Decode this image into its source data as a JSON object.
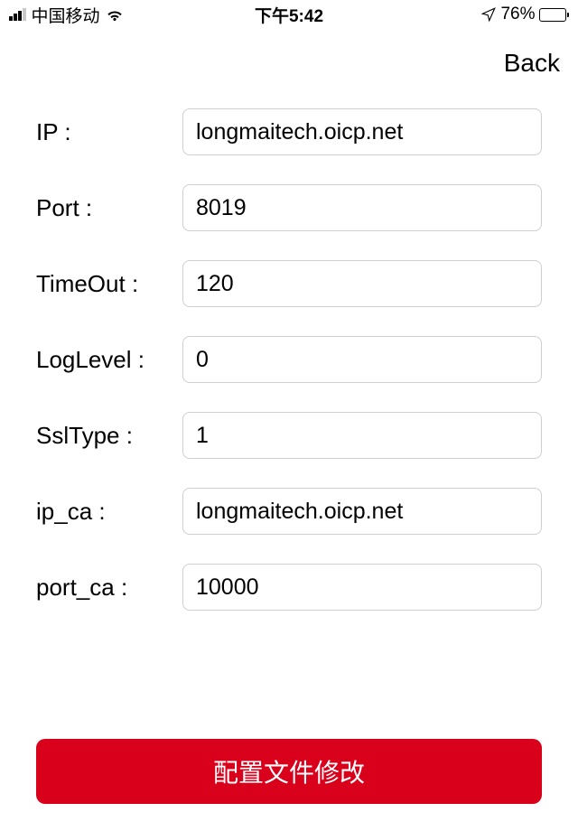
{
  "status_bar": {
    "carrier": "中国移动",
    "time": "下午5:42",
    "battery_percent": "76%",
    "battery_fill_pct": 76
  },
  "nav": {
    "back_label": "Back"
  },
  "form": {
    "fields": [
      {
        "label": "IP :",
        "value": "longmaitech.oicp.net"
      },
      {
        "label": "Port :",
        "value": "8019"
      },
      {
        "label": "TimeOut :",
        "value": "120"
      },
      {
        "label": "LogLevel :",
        "value": "0"
      },
      {
        "label": "SslType :",
        "value": "1"
      },
      {
        "label": "ip_ca :",
        "value": "longmaitech.oicp.net"
      },
      {
        "label": "port_ca :",
        "value": "10000"
      }
    ]
  },
  "submit": {
    "label": "配置文件修改"
  }
}
